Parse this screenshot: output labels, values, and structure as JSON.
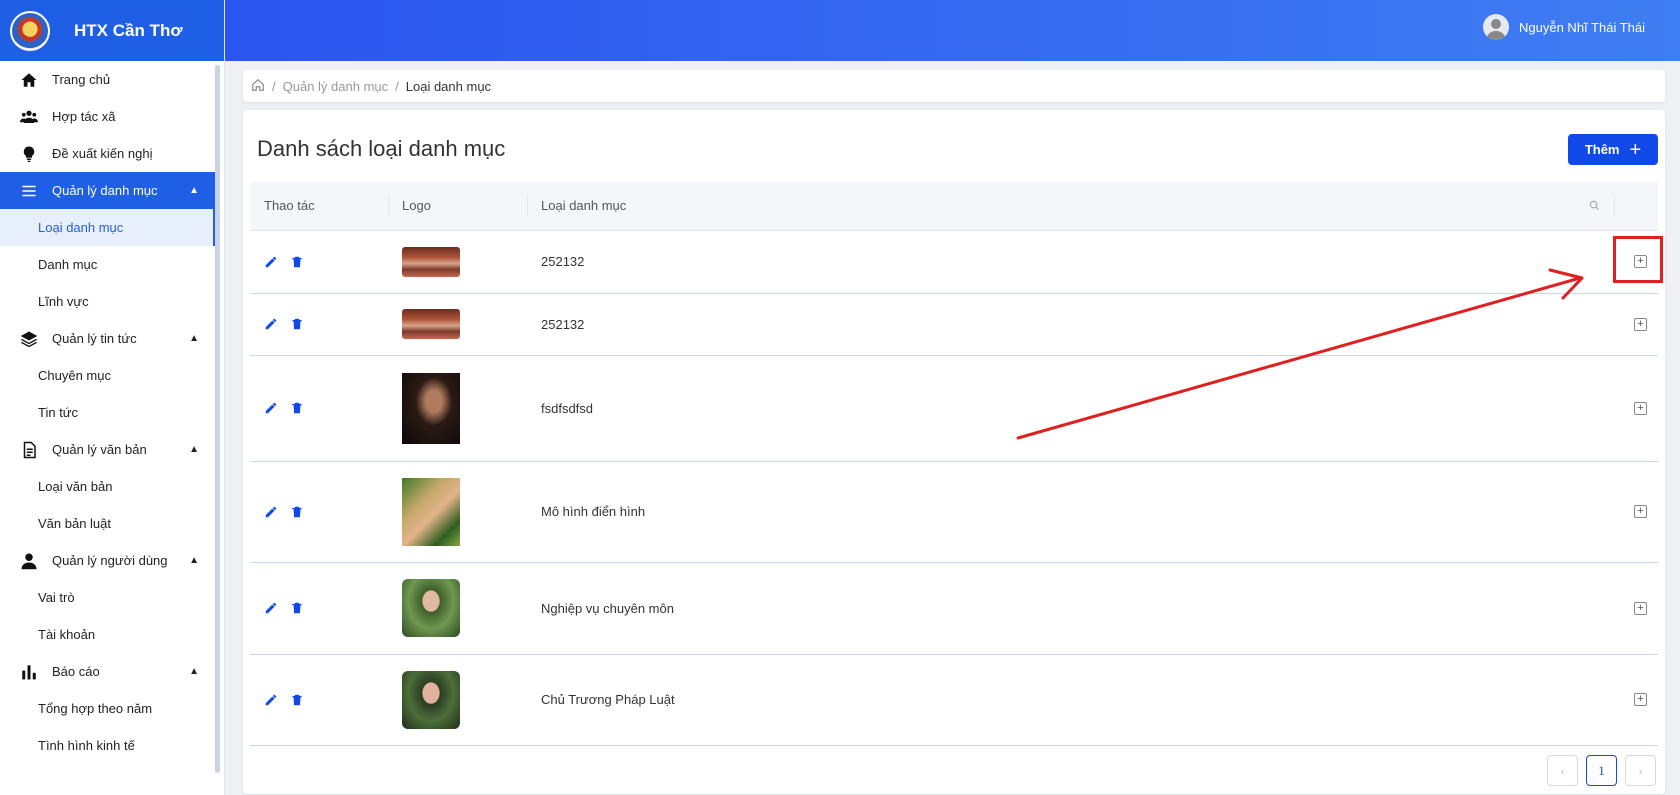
{
  "brand": {
    "name": "HTX Cần Thơ"
  },
  "header": {
    "user_name": "Nguyễn Nhĩ Thái Thái"
  },
  "sidebar": {
    "items": [
      {
        "label": "Trang chủ",
        "icon": "home-icon"
      },
      {
        "label": "Hợp tác xã",
        "icon": "users-icon"
      },
      {
        "label": "Đề xuất kiến nghị",
        "icon": "lightbulb-icon"
      },
      {
        "label": "Quản lý danh mục",
        "icon": "menu-icon",
        "active": true,
        "children": [
          "Loại danh mục",
          "Danh mục",
          "Lĩnh vực"
        ]
      },
      {
        "label": "Quản lý tin tức",
        "icon": "layers-icon",
        "children": [
          "Chuyên mục",
          "Tin tức"
        ]
      },
      {
        "label": "Quản lý văn bản",
        "icon": "document-icon",
        "children": [
          "Loại văn bản",
          "Văn bản luật"
        ]
      },
      {
        "label": "Quản lý người dùng",
        "icon": "user-icon",
        "children": [
          "Vai trò",
          "Tài khoản"
        ]
      },
      {
        "label": "Báo cáo",
        "icon": "bar-chart-icon",
        "children": [
          "Tổng hợp theo năm",
          "Tình hình kinh tế"
        ]
      }
    ]
  },
  "breadcrumb": {
    "items": [
      "Quản lý danh mục",
      "Loại danh mục"
    ]
  },
  "page": {
    "title": "Danh sách loại danh mục",
    "add_label": "Thêm"
  },
  "table": {
    "columns": [
      "Thao tác",
      "Logo",
      "Loại danh mục"
    ],
    "rows": [
      {
        "name": "252132"
      },
      {
        "name": "252132"
      },
      {
        "name": "fsdfsdfsd"
      },
      {
        "name": "Mô hình điển hình"
      },
      {
        "name": "Nghiệp vụ chuyên môn"
      },
      {
        "name": "Chủ Trương Pháp Luật"
      }
    ]
  },
  "pagination": {
    "current": "1"
  },
  "colors": {
    "primary": "#1149e8",
    "header_start": "#2b55f0",
    "annotation": "#e0201f"
  }
}
